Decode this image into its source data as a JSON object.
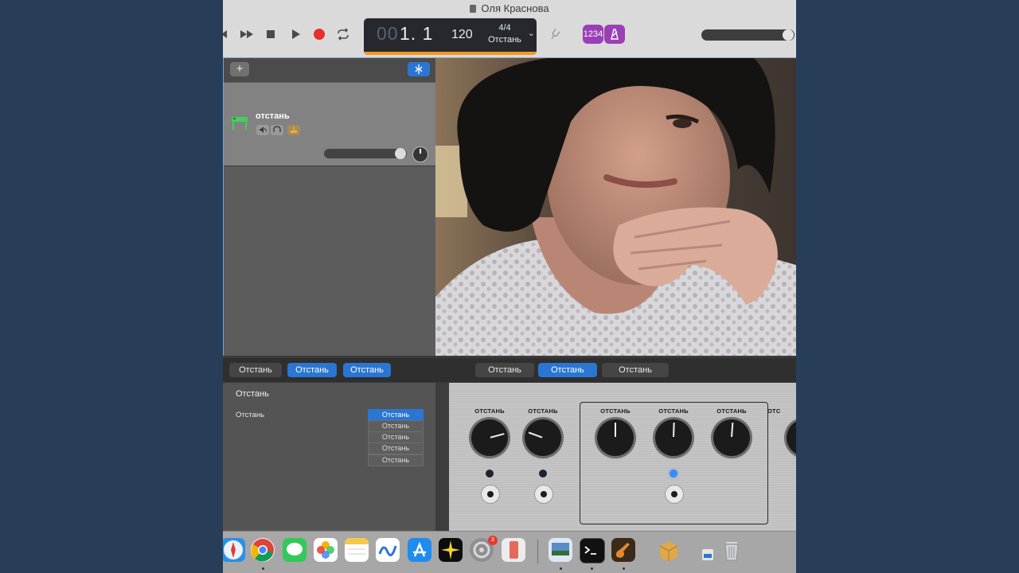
{
  "window": {
    "title": "Оля Краснова"
  },
  "transport": {
    "position_dim": "00",
    "position": "1. 1",
    "tempo": "120",
    "time_signature": "4/4",
    "key": "Отстань",
    "count_in": "1234"
  },
  "track": {
    "name": "отстань"
  },
  "editor": {
    "left_tabs": [
      "Отстань",
      "Отстань",
      "Отстань"
    ],
    "right_tabs": [
      "Отстань",
      "Отстань",
      "Отстань"
    ],
    "panel_title": "Отстань",
    "row_label": "Отстань",
    "options": [
      "Отстань",
      "Отстань",
      "Отстань",
      "Отстань",
      "Отстань"
    ]
  },
  "amp": {
    "knob_labels": [
      "ОТСТАНЬ",
      "ОТСТАНЬ",
      "ОТСТАНЬ",
      "ОТСТАНЬ",
      "ОТСТАНЬ",
      "ОТС"
    ]
  },
  "dock": {
    "notification_badge": "3"
  },
  "colors": {
    "accent": "#2a76d2",
    "record": "#e8302a",
    "lcd_bar": "#f39a1c",
    "purple": "#9a3fb5"
  }
}
